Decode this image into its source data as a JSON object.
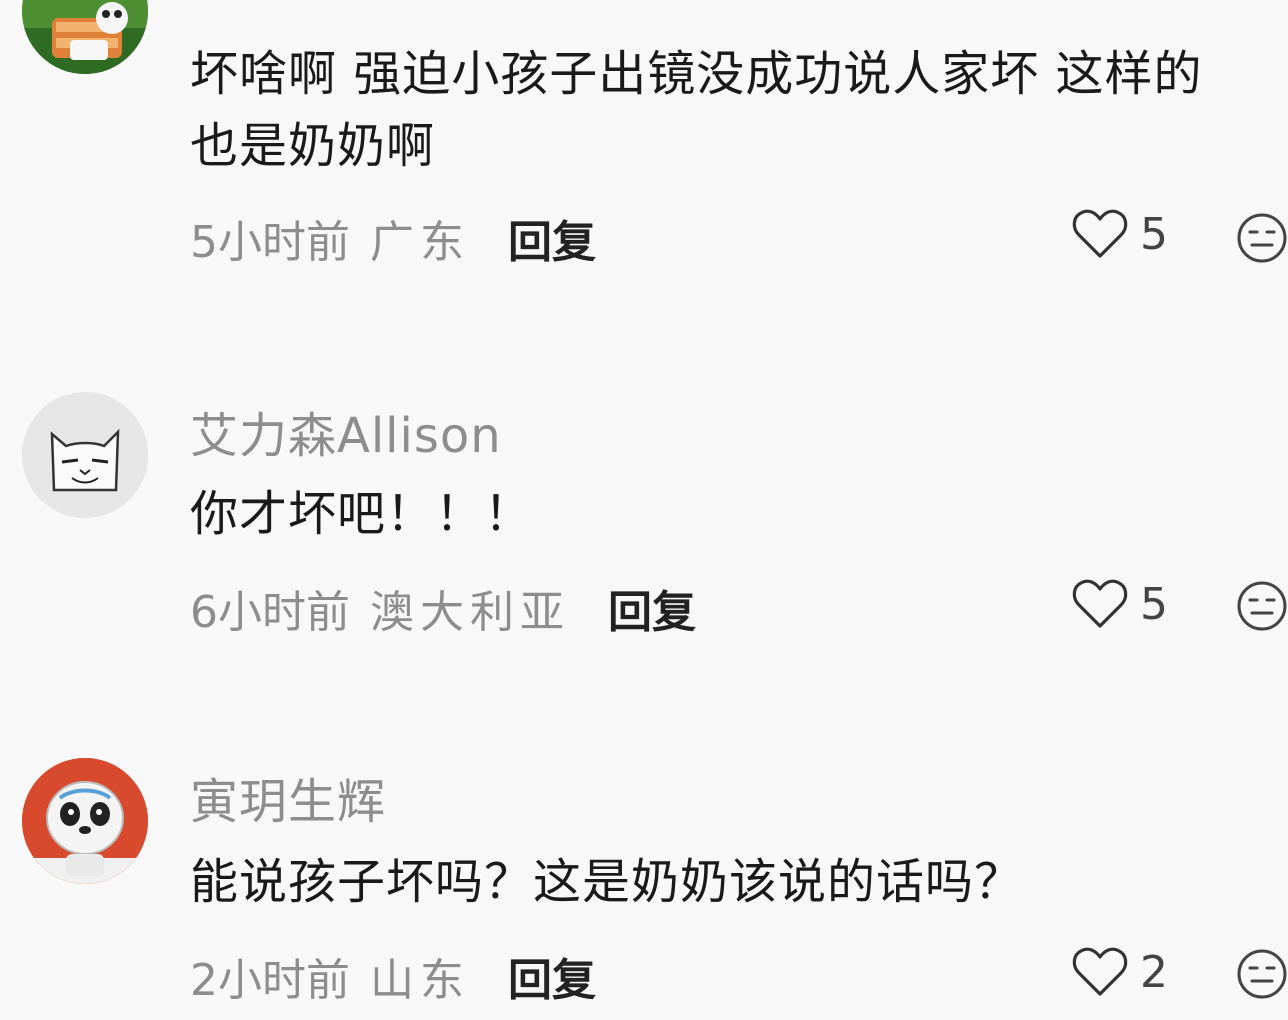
{
  "comments": [
    {
      "username": "",
      "text_lines": [
        "坏啥啊 强迫小孩子出镜没成功说人家坏 这样的",
        "也是奶奶啊"
      ],
      "time": "5小时前",
      "region": "广东",
      "reply_label": "回复",
      "likes": "5",
      "avatar_icon": "cartoon-avatar-icon"
    },
    {
      "username": "艾力森Allison",
      "text_lines": [
        "你才坏吧！！！"
      ],
      "time": "6小时前",
      "region": "澳大利亚",
      "reply_label": "回复",
      "likes": "5",
      "avatar_icon": "cat-sketch-avatar-icon"
    },
    {
      "username": "寅玥生辉",
      "text_lines": [
        "能说孩子坏吗？这是奶奶该说的话吗？"
      ],
      "time": "2小时前",
      "region": "山东",
      "reply_label": "回复",
      "likes": "2",
      "avatar_icon": "panda-mascot-avatar-icon"
    }
  ],
  "colors": {
    "background": "#f8f8f8",
    "meta_text": "#8d8d8d",
    "body_text": "#1a1a1a"
  }
}
